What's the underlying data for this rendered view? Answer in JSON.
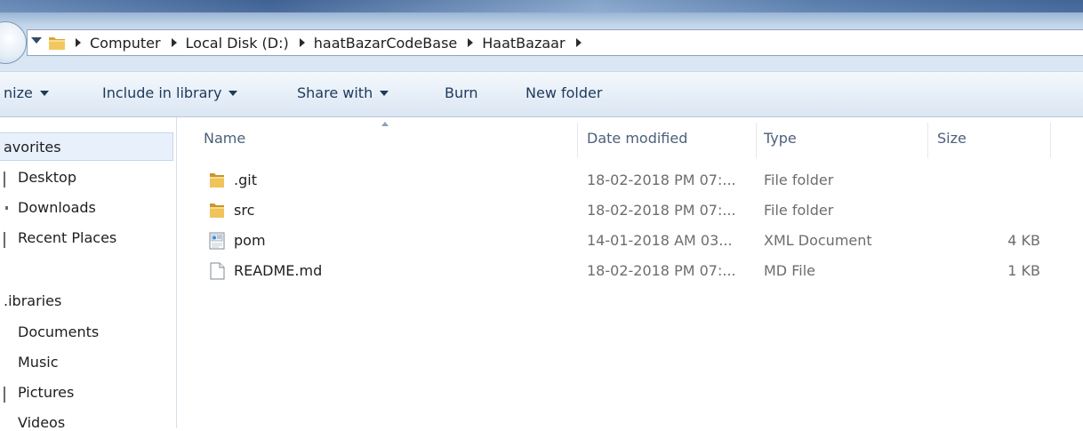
{
  "breadcrumb": [
    "Computer",
    "Local Disk (D:)",
    "haatBazarCodeBase",
    "HaatBazaar"
  ],
  "toolbar": {
    "organize": "nize",
    "include_in_library": "Include in library",
    "share_with": "Share with",
    "burn": "Burn",
    "new_folder": "New folder"
  },
  "nav": {
    "favorites": "avorites",
    "favorites_items": [
      "Desktop",
      "Downloads",
      "Recent Places"
    ],
    "libraries": ".ibraries",
    "libraries_items": [
      "Documents",
      "Music",
      "Pictures",
      "Videos"
    ]
  },
  "columns": {
    "name": "Name",
    "date": "Date modified",
    "type": "Type",
    "size": "Size"
  },
  "files": [
    {
      "name": ".git",
      "date": "18-02-2018 PM 07:...",
      "type": "File folder",
      "size": "",
      "icon": "folder-icon"
    },
    {
      "name": "src",
      "date": "18-02-2018 PM 07:...",
      "type": "File folder",
      "size": "",
      "icon": "folder-icon"
    },
    {
      "name": "pom",
      "date": "14-01-2018 AM 03...",
      "type": "XML Document",
      "size": "4 KB",
      "icon": "xml-document-icon"
    },
    {
      "name": "README.md",
      "date": "18-02-2018 PM 07:...",
      "type": "MD File",
      "size": "1 KB",
      "icon": "blank-file-icon"
    }
  ],
  "colors": {
    "accent": "#1e395b",
    "selection": "#e8f1fb",
    "folder": "#e8b84a"
  }
}
